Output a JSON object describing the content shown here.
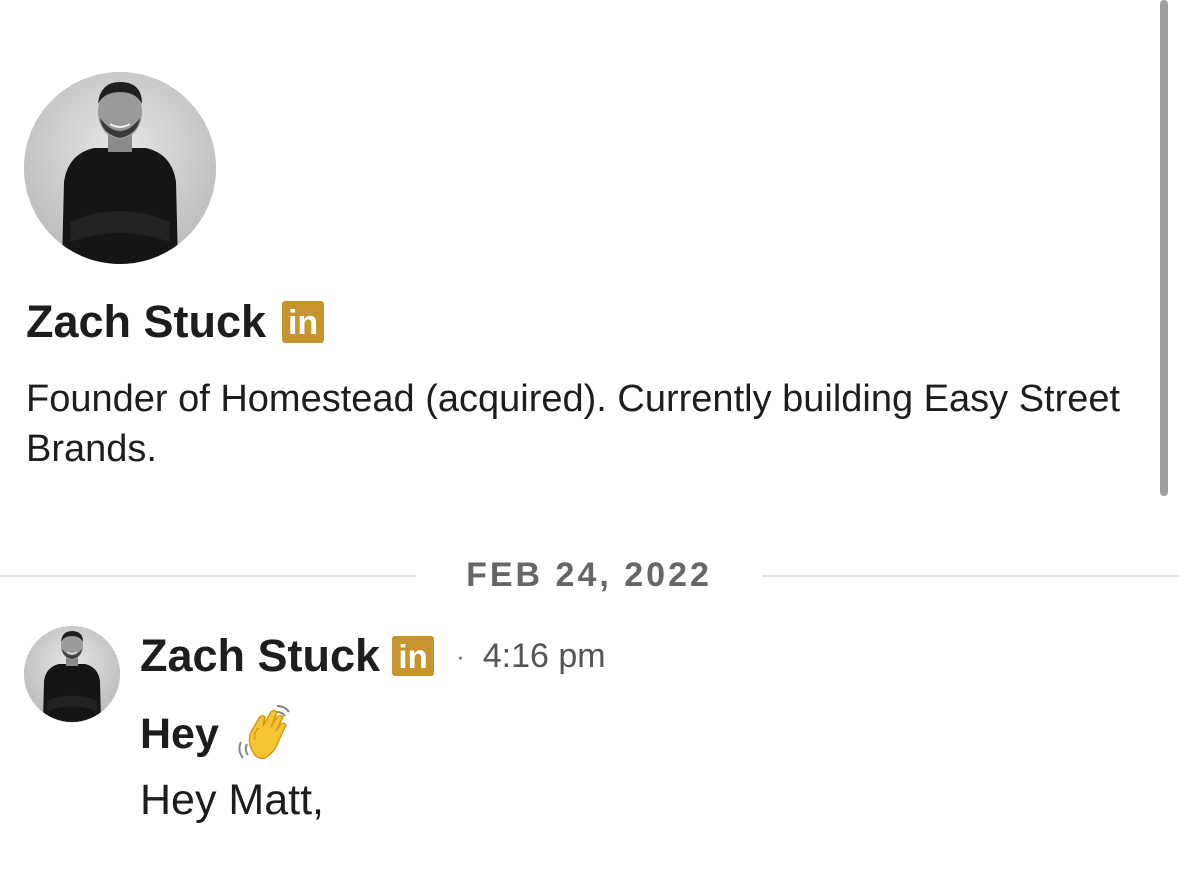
{
  "profile": {
    "name": "Zach Stuck",
    "badge": "in",
    "headline": "Founder of Homestead (acquired). Currently building Easy Street Brands."
  },
  "conversation": {
    "date_divider": "FEB 24, 2022",
    "message": {
      "sender": "Zach Stuck",
      "badge": "in",
      "separator": "·",
      "time": "4:16 pm",
      "subject": "Hey",
      "body": "Hey Matt,"
    }
  },
  "icons": {
    "badge_icon": "linkedin-badge-icon",
    "emoji": "waving-hand-icon"
  },
  "colors": {
    "badge": "#c7952e",
    "divider": "#e3e3e3",
    "secondary_text": "#666666",
    "primary_text": "#1d1d1d"
  }
}
